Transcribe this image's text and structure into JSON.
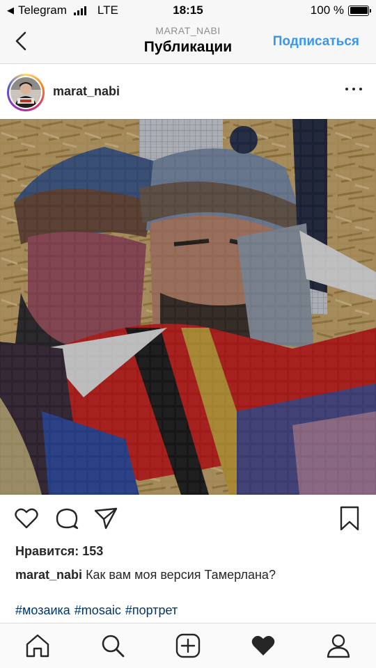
{
  "status_bar": {
    "carrier": "Telegram",
    "network": "LTE",
    "time": "18:15",
    "battery": "100 %",
    "battery_level": 1.0
  },
  "nav": {
    "subtitle": "MARAT_NABI",
    "title": "Публикации",
    "follow_label": "Подписаться",
    "back_icon": "chevron-left-icon"
  },
  "post": {
    "username": "marat_nabi",
    "more_icon": "more-horizontal-icon",
    "image_subject": "mosaic-portrait",
    "likes_label": "Нравится:",
    "likes_count": "153",
    "caption_user": "marat_nabi",
    "caption_text": "Как вам моя версия Тамерлана?",
    "hashtags": [
      "#мозаика",
      "#mosaic",
      "#портрет"
    ]
  },
  "actions": [
    "heart-icon",
    "comment-icon",
    "share-icon",
    "bookmark-icon"
  ],
  "tabbar": [
    "home-icon",
    "search-icon",
    "new-post-icon",
    "activity-heart-icon",
    "profile-icon"
  ],
  "colors": {
    "accent": "#3897f0",
    "hashtag": "#003569",
    "text": "#262626"
  }
}
